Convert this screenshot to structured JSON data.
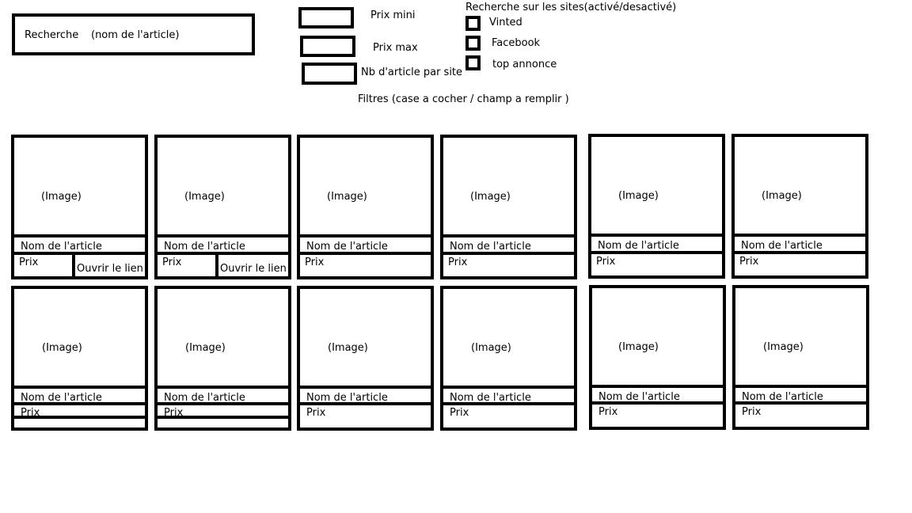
{
  "search": {
    "label": "Recherche",
    "placeholder": "(nom de l'article)"
  },
  "filters": {
    "price_min_label": "Prix mini",
    "price_max_label": "Prix max",
    "per_site_label": "Nb d'article par site",
    "footer_label": "Filtres (case a cocher / champ a remplir )",
    "sites_title": "Recherche sur les sites(activé/desactivé)",
    "sites": [
      "Vinted",
      "Facebook",
      "top annonce"
    ]
  },
  "card": {
    "image_label": "(Image)",
    "name_label": "Nom de l'article",
    "price_label": "Prix",
    "link_label": "Ouvrir le lien"
  }
}
